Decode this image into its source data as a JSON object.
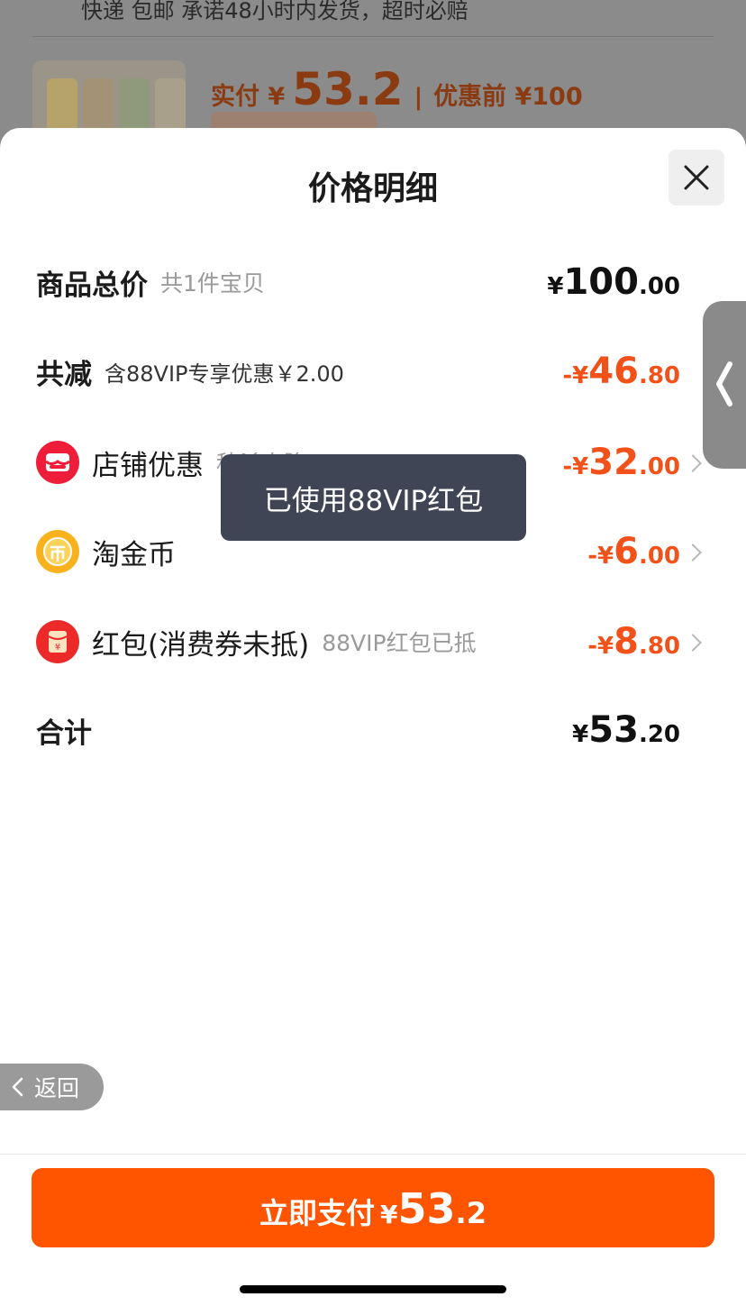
{
  "background": {
    "shipping_text": "快递 包邮 承诺48小时内发货，超时必赔",
    "paid_label": "实付 ¥",
    "paid_amount": "53.2",
    "separator": "|",
    "original_label": "优惠前 ¥100"
  },
  "sheet": {
    "title": "价格明细"
  },
  "rows": {
    "total": {
      "label": "商品总价",
      "sub": "共1件宝贝",
      "currency": "¥",
      "integer": "100",
      "decimal": ".00"
    },
    "reduction": {
      "label": "共减",
      "sub": "含88VIP专享优惠￥2.00",
      "currency": "-¥",
      "integer": "46",
      "decimal": ".80"
    },
    "shop": {
      "label": "店铺优惠",
      "sub": "秒杀直降",
      "currency": "-¥",
      "integer": "32",
      "decimal": ".00"
    },
    "coins": {
      "label": "淘金币",
      "currency": "-¥",
      "integer": "6",
      "decimal": ".00"
    },
    "redpacket": {
      "label": "红包(消费券未抵)",
      "sub": "88VIP红包已抵",
      "currency": "-¥",
      "integer": "8",
      "decimal": ".80"
    },
    "sum": {
      "label": "合计",
      "currency": "¥",
      "integer": "53",
      "decimal": ".20"
    }
  },
  "toast": {
    "text": "已使用88VIP红包"
  },
  "back": {
    "label": "返回"
  },
  "pay": {
    "label": "立即支付",
    "currency": "¥",
    "integer": "53",
    "decimal": ".2"
  },
  "colors": {
    "accent": "#ff5400",
    "discount": "#f2521a",
    "toast_bg": "#3f4554",
    "shop_icon": "#ee1e3b",
    "coin_icon": "#f7b21e",
    "redpacket_icon": "#ec2a2a"
  },
  "icons": {
    "close": "close-icon",
    "shop": "shop-icon",
    "coin": "coin-icon",
    "redpacket": "red-packet-icon",
    "back": "chevron-left-icon",
    "handle": "chevron-left-icon"
  }
}
